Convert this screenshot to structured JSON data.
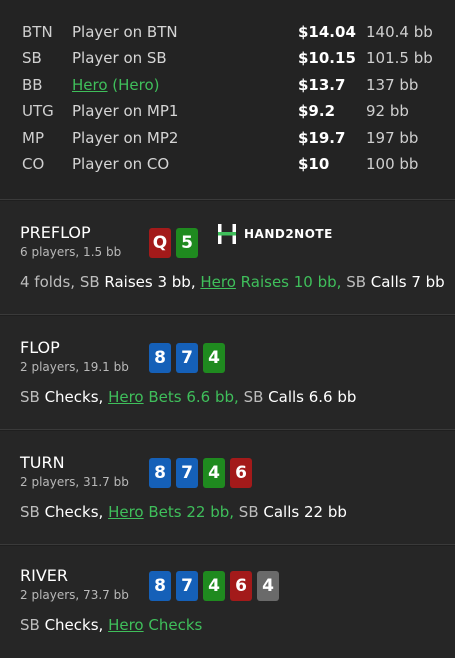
{
  "seats": [
    {
      "pos": "BTN",
      "name": "Player on BTN",
      "stack": "$14.04",
      "bb": "140.4 bb",
      "hero": false
    },
    {
      "pos": "SB",
      "name": "Player on SB",
      "stack": "$10.15",
      "bb": "101.5 bb",
      "hero": false
    },
    {
      "pos": "BB",
      "name": "Hero",
      "name_suffix": " (Hero)",
      "stack": "$13.7",
      "bb": "137 bb",
      "hero": true
    },
    {
      "pos": "UTG",
      "name": "Player on MP1",
      "stack": "$9.2",
      "bb": "92 bb",
      "hero": false
    },
    {
      "pos": "MP",
      "name": "Player on MP2",
      "stack": "$19.7",
      "bb": "197 bb",
      "hero": false
    },
    {
      "pos": "CO",
      "name": "Player on CO",
      "stack": "$10",
      "bb": "100 bb",
      "hero": false
    }
  ],
  "logo": {
    "text": "HAND2NOTE"
  },
  "card_colors": {
    "spades": "#6a6a6a",
    "hearts": "#a31a1a",
    "diamonds": "#1560b8",
    "clubs": "#1f8a1f"
  },
  "streets": [
    {
      "title": "PREFLOP",
      "subtitle": "6 players, 1.5 bb",
      "cards": [
        {
          "rank": "Q",
          "suit": "hearts"
        },
        {
          "rank": "5",
          "suit": "clubs"
        }
      ],
      "actions": [
        [
          {
            "t": "4 folds, ",
            "c": "pos"
          },
          {
            "t": "SB",
            "c": "pos"
          },
          {
            "t": " Raises 3 bb, ",
            "c": "verb"
          },
          {
            "t": "Hero",
            "c": "hero"
          },
          {
            "t": " Raises 10 bb, ",
            "c": "hero-verb"
          },
          {
            "t": "SB",
            "c": "pos"
          },
          {
            "t": " Calls 7 bb",
            "c": "verb"
          }
        ]
      ]
    },
    {
      "title": "FLOP",
      "subtitle": "2 players, 19.1 bb",
      "cards": [
        {
          "rank": "8",
          "suit": "diamonds"
        },
        {
          "rank": "7",
          "suit": "diamonds"
        },
        {
          "rank": "4",
          "suit": "clubs"
        }
      ],
      "actions": [
        [
          {
            "t": "SB",
            "c": "pos"
          },
          {
            "t": " Checks, ",
            "c": "verb"
          },
          {
            "t": "Hero",
            "c": "hero"
          },
          {
            "t": " Bets 6.6 bb, ",
            "c": "hero-verb"
          },
          {
            "t": "SB",
            "c": "pos"
          },
          {
            "t": " Calls 6.6 bb",
            "c": "verb"
          }
        ]
      ]
    },
    {
      "title": "TURN",
      "subtitle": "2 players, 31.7 bb",
      "cards": [
        {
          "rank": "8",
          "suit": "diamonds"
        },
        {
          "rank": "7",
          "suit": "diamonds"
        },
        {
          "rank": "4",
          "suit": "clubs"
        },
        {
          "rank": "6",
          "suit": "hearts"
        }
      ],
      "actions": [
        [
          {
            "t": "SB",
            "c": "pos"
          },
          {
            "t": " Checks, ",
            "c": "verb"
          },
          {
            "t": "Hero",
            "c": "hero"
          },
          {
            "t": " Bets 22 bb, ",
            "c": "hero-verb"
          },
          {
            "t": "SB",
            "c": "pos"
          },
          {
            "t": " Calls 22 bb",
            "c": "verb"
          }
        ]
      ]
    },
    {
      "title": "RIVER",
      "subtitle": "2 players, 73.7 bb",
      "cards": [
        {
          "rank": "8",
          "suit": "diamonds"
        },
        {
          "rank": "7",
          "suit": "diamonds"
        },
        {
          "rank": "4",
          "suit": "clubs"
        },
        {
          "rank": "6",
          "suit": "hearts"
        },
        {
          "rank": "4",
          "suit": "spades"
        }
      ],
      "actions": [
        [
          {
            "t": "SB",
            "c": "pos"
          },
          {
            "t": " Checks, ",
            "c": "verb"
          },
          {
            "t": "Hero",
            "c": "hero"
          },
          {
            "t": " Checks",
            "c": "hero-verb"
          }
        ]
      ]
    }
  ]
}
